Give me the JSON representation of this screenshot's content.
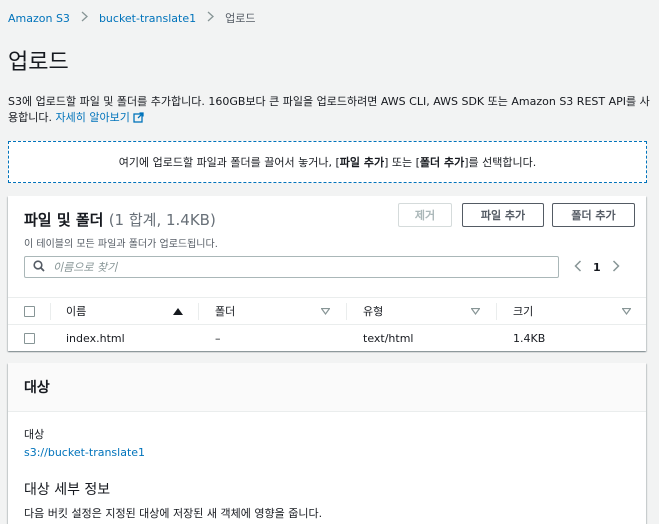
{
  "breadcrumb": {
    "items": [
      "Amazon S3",
      "bucket-translate1"
    ],
    "current": "업로드"
  },
  "page": {
    "title": "업로드",
    "description": "S3에 업로드할 파일 및 폴더를 추가합니다. 160GB보다 큰 파일을 업로드하려면 AWS CLI, AWS SDK 또는 Amazon S3 REST API를 사용합니다.",
    "learn_more": "자세히 알아보기"
  },
  "dropzone": {
    "text_before": "여기에 업로드할 파일과 폴더를 끌어서 놓거나, [",
    "add_files": "파일 추가",
    "middle": "] 또는 [",
    "add_folder": "폴더 추가",
    "text_after": "]를 선택합니다."
  },
  "files_panel": {
    "title": "파일 및 폴더",
    "count": "(1 합계, 1.4KB)",
    "subtitle": "이 테이블의 모든 파일과 폴더가 업로드됩니다.",
    "remove_button": "제거",
    "add_files_button": "파일 추가",
    "add_folder_button": "폴더 추가",
    "search_placeholder": "이름으로 찾기",
    "current_page": "1",
    "columns": [
      "이름",
      "폴더",
      "유형",
      "크기"
    ],
    "rows": [
      {
        "name": "index.html",
        "folder": "–",
        "type": "text/html",
        "size": "1.4KB"
      }
    ]
  },
  "destination": {
    "header": "대상",
    "label": "대상",
    "path": "s3://bucket-translate1",
    "details_title": "대상 세부 정보",
    "details_desc": "다음 버킷 설정은 지정된 대상에 저장된 새 객체에 영향을 줍니다."
  },
  "colors": {
    "link": "#0073bb",
    "background": "#f2f3f3",
    "text": "#16191f"
  }
}
